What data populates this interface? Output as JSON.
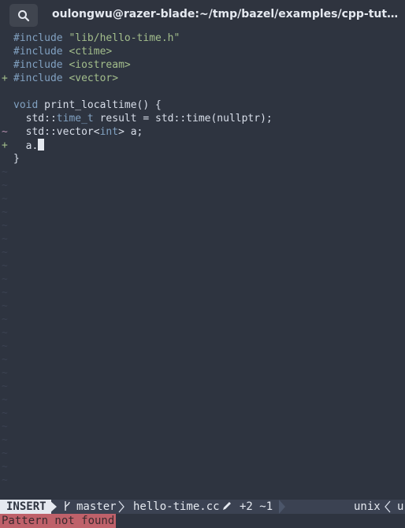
{
  "window": {
    "title": "oulongwu@razer-blade:~/tmp/bazel/examples/cpp-tutorial/sta..."
  },
  "editor": {
    "lines": [
      {
        "sign": "",
        "parts": [
          [
            "pp",
            "#include "
          ],
          [
            "str",
            "\"lib/hello-time.h\""
          ]
        ]
      },
      {
        "sign": "",
        "parts": [
          [
            "pp",
            "#include "
          ],
          [
            "str",
            "<ctime>"
          ]
        ]
      },
      {
        "sign": "",
        "parts": [
          [
            "pp",
            "#include "
          ],
          [
            "str",
            "<iostream>"
          ]
        ]
      },
      {
        "sign": "+",
        "parts": [
          [
            "pp",
            "#include "
          ],
          [
            "str",
            "<vector>"
          ]
        ]
      },
      {
        "sign": "",
        "parts": []
      },
      {
        "sign": "",
        "parts": [
          [
            "kw",
            "void"
          ],
          [
            "n",
            " print_localtime() {"
          ]
        ]
      },
      {
        "sign": "",
        "parts": [
          [
            "n",
            "  std::"
          ],
          [
            "ty",
            "time_t"
          ],
          [
            "n",
            " result = std::time(nullptr);"
          ]
        ]
      },
      {
        "sign": "~",
        "parts": [
          [
            "n",
            "  std::vector<"
          ],
          [
            "ty",
            "int"
          ],
          [
            "n",
            "> a;"
          ]
        ]
      },
      {
        "sign": "+",
        "parts": [
          [
            "n",
            "  a."
          ]
        ],
        "cursor": true
      },
      {
        "sign": "",
        "parts": [
          [
            "n",
            "}"
          ]
        ]
      }
    ],
    "empty_marker": "~"
  },
  "statusline": {
    "mode": "INSERT",
    "branch_icon": "branch-icon",
    "branch": "master",
    "filename": "hello-time.cc",
    "modified_icon": "pencil-icon",
    "diff": "+2 ~1",
    "fileformat": "unix",
    "overflow": "u"
  },
  "message": "Pattern not found",
  "colors": {
    "background": "#2e3440",
    "error_bg": "#bf616a",
    "added": "#a3be8c",
    "keyword": "#81a1c1"
  }
}
